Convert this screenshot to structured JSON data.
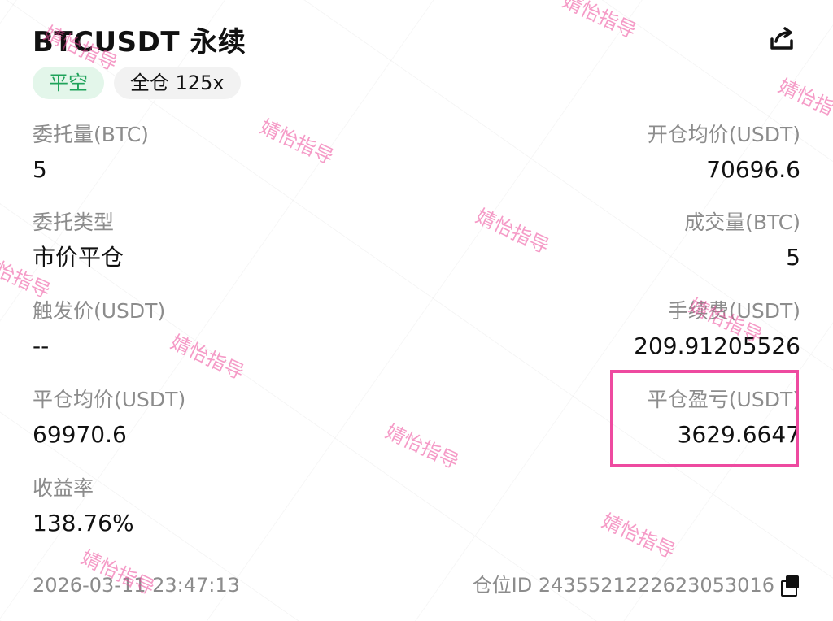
{
  "header": {
    "title": "BTCUSDT 永续",
    "share_icon": "share-icon"
  },
  "tags": {
    "side": "平空",
    "mode": "全仓 125x"
  },
  "fields": {
    "order_qty": {
      "label": "委托量(BTC)",
      "value": "5"
    },
    "open_avg_price": {
      "label": "开仓均价(USDT)",
      "value": "70696.6"
    },
    "order_type": {
      "label": "委托类型",
      "value": "市价平仓"
    },
    "filled_qty": {
      "label": "成交量(BTC)",
      "value": "5"
    },
    "trigger_price": {
      "label": "触发价(USDT)",
      "value": "--"
    },
    "fee": {
      "label": "手续费(USDT)",
      "value": "209.91205526"
    },
    "close_avg_price": {
      "label": "平仓均价(USDT)",
      "value": "69970.6"
    },
    "close_pnl": {
      "label": "平仓盈亏(USDT)",
      "value": "3629.6647"
    },
    "roi": {
      "label": "收益率",
      "value": "138.76%"
    }
  },
  "footer": {
    "timestamp": "2026-03-11 23:47:13",
    "position_id": "仓位ID 2435521222623053016",
    "copy_icon": "copy-icon"
  },
  "watermark": {
    "text": "婧怡指导"
  },
  "colors": {
    "accent_green": "#1fa35a",
    "tag_green_bg": "#e3f6ea",
    "highlight_pink": "#ee4aa0",
    "label_gray": "#8c8c8c"
  }
}
